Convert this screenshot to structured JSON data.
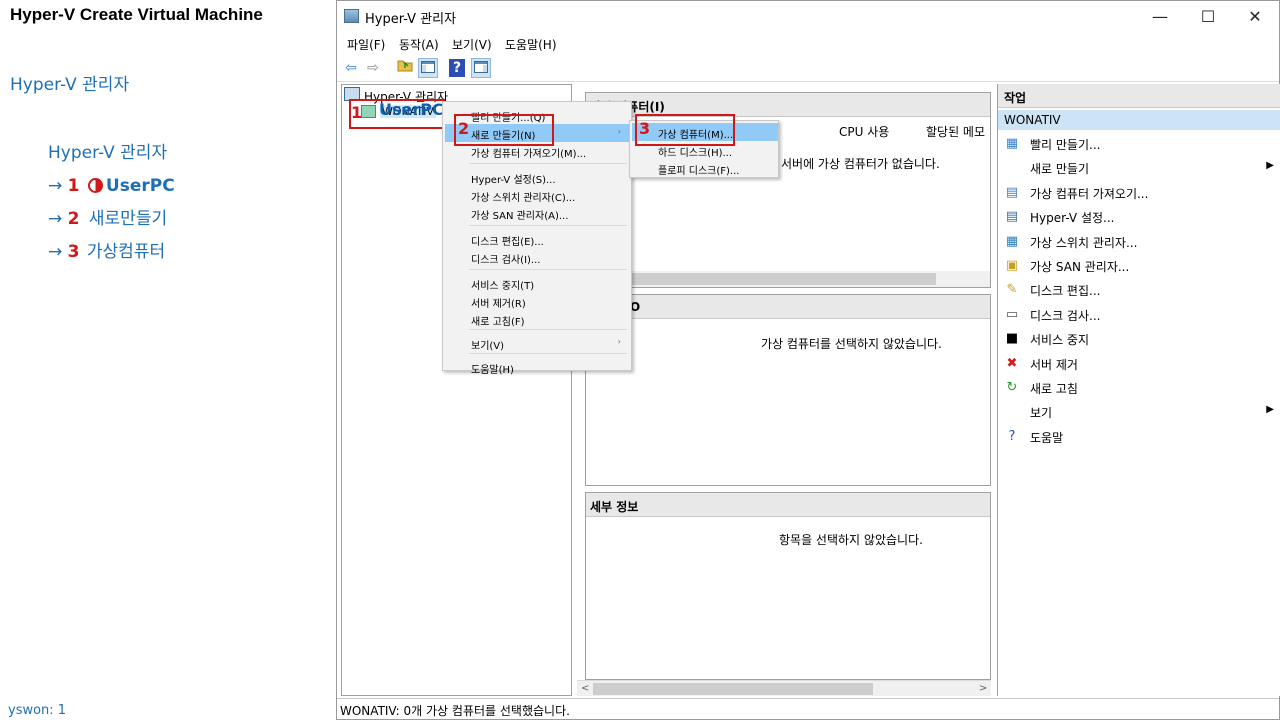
{
  "tutorial": {
    "title": "Hyper-V Create Virtual Machine",
    "subtitle": "Hyper-V 관리자",
    "step_root": "Hyper-V 관리자",
    "step1_arrow": "→ ",
    "step1_num": "1",
    "step1_text": "UserPC",
    "step2_arrow": "→ ",
    "step2_num": "2",
    "step2_text": "새로만들기",
    "step3_arrow": "→ ",
    "step3_num": "3",
    "step3_text": "가상컴퓨터",
    "footer": "yswon:   1"
  },
  "window": {
    "title": "Hyper-V 관리자",
    "minimize": "—",
    "maximize": "☐",
    "close": "✕"
  },
  "menubar": [
    "파일(F)",
    "동작(A)",
    "보기(V)",
    "도움말(H)"
  ],
  "toolbar": {
    "back": "⇦",
    "forward": "⇨",
    "help": "?"
  },
  "tree": {
    "root": "Hyper-V 관리자",
    "node": "WONATIV",
    "annotation_num": "1",
    "annotation_label": "UserPC"
  },
  "vm_panel": {
    "title": "가상 컴퓨터(I)",
    "columns": [
      "CPU 사용",
      "할당된 메모"
    ],
    "empty": "서버에 가상 컴퓨터가 없습니다."
  },
  "snap_panel": {
    "title_fragment": "O",
    "empty": "가상 컴퓨터를 선택하지 않았습니다."
  },
  "detail_panel": {
    "title": "세부 정보",
    "empty": "항목을 선택하지 않았습니다."
  },
  "scroll": {
    "left": "<",
    "right": ">"
  },
  "actions": {
    "title": "작업",
    "group": "WONATIV",
    "items": [
      {
        "icon": "▦",
        "label": "빨리 만들기..."
      },
      {
        "icon": "",
        "label": "새로 만들기",
        "arrow": "▶"
      },
      {
        "icon": "▤",
        "label": "가상 컴퓨터 가져오기..."
      },
      {
        "icon": "▤",
        "label": "Hyper-V 설정..."
      },
      {
        "icon": "▦",
        "label": "가상 스위치 관리자..."
      },
      {
        "icon": "▣",
        "label": "가상 SAN 관리자..."
      },
      {
        "icon": "✎",
        "label": "디스크 편집..."
      },
      {
        "icon": "▭",
        "label": "디스크 검사..."
      },
      {
        "icon": "■",
        "label": "서비스 중지"
      },
      {
        "icon": "✖",
        "label": "서버 제거"
      },
      {
        "icon": "↻",
        "label": "새로 고침"
      },
      {
        "icon": "",
        "label": "보기",
        "arrow": "▶"
      },
      {
        "icon": "?",
        "label": "도움말"
      }
    ]
  },
  "context_menu": {
    "items": [
      {
        "label": "빨리 만들기...(Q)"
      },
      {
        "label": "새로 만들기(N)",
        "arrow": "›",
        "highlight": true
      },
      {
        "label": "가상 컴퓨터 가져오기(M)..."
      },
      {
        "label": "Hyper-V 설정(S)..."
      },
      {
        "label": "가상 스위치 관리자(C)..."
      },
      {
        "label": "가상 SAN 관리자(A)..."
      },
      {
        "label": "디스크 편집(E)..."
      },
      {
        "label": "디스크 검사(I)..."
      },
      {
        "label": "서비스 중지(T)"
      },
      {
        "label": "서버 제거(R)"
      },
      {
        "label": "새로 고침(F)"
      },
      {
        "label": "보기(V)",
        "arrow": "›"
      },
      {
        "label": "도움말(H)"
      }
    ],
    "annotation_num": "2"
  },
  "submenu": {
    "items": [
      {
        "label": "가상 컴퓨터(M)...",
        "highlight": true
      },
      {
        "label": "하드 디스크(H)..."
      },
      {
        "label": "플로피 디스크(F)..."
      }
    ],
    "annotation_num": "3"
  },
  "statusbar": {
    "text": "WONATIV:  0개 가상 컴퓨터를 선택했습니다."
  },
  "colors": {
    "accent_blue": "#1f6fb5",
    "annotation_red": "#d01818",
    "highlight": "#91c9f7"
  }
}
